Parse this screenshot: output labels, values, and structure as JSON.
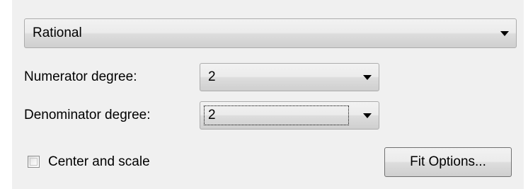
{
  "fit_type": {
    "selected": "Rational"
  },
  "numerator": {
    "label": "Numerator degree:",
    "selected": "2"
  },
  "denominator": {
    "label": "Denominator degree:",
    "selected": "2"
  },
  "center_and_scale": {
    "label": "Center and scale",
    "checked": false
  },
  "fit_options_button": {
    "label": "Fit Options..."
  },
  "icons": {
    "dropdown_arrow": "chevron-down-icon"
  }
}
